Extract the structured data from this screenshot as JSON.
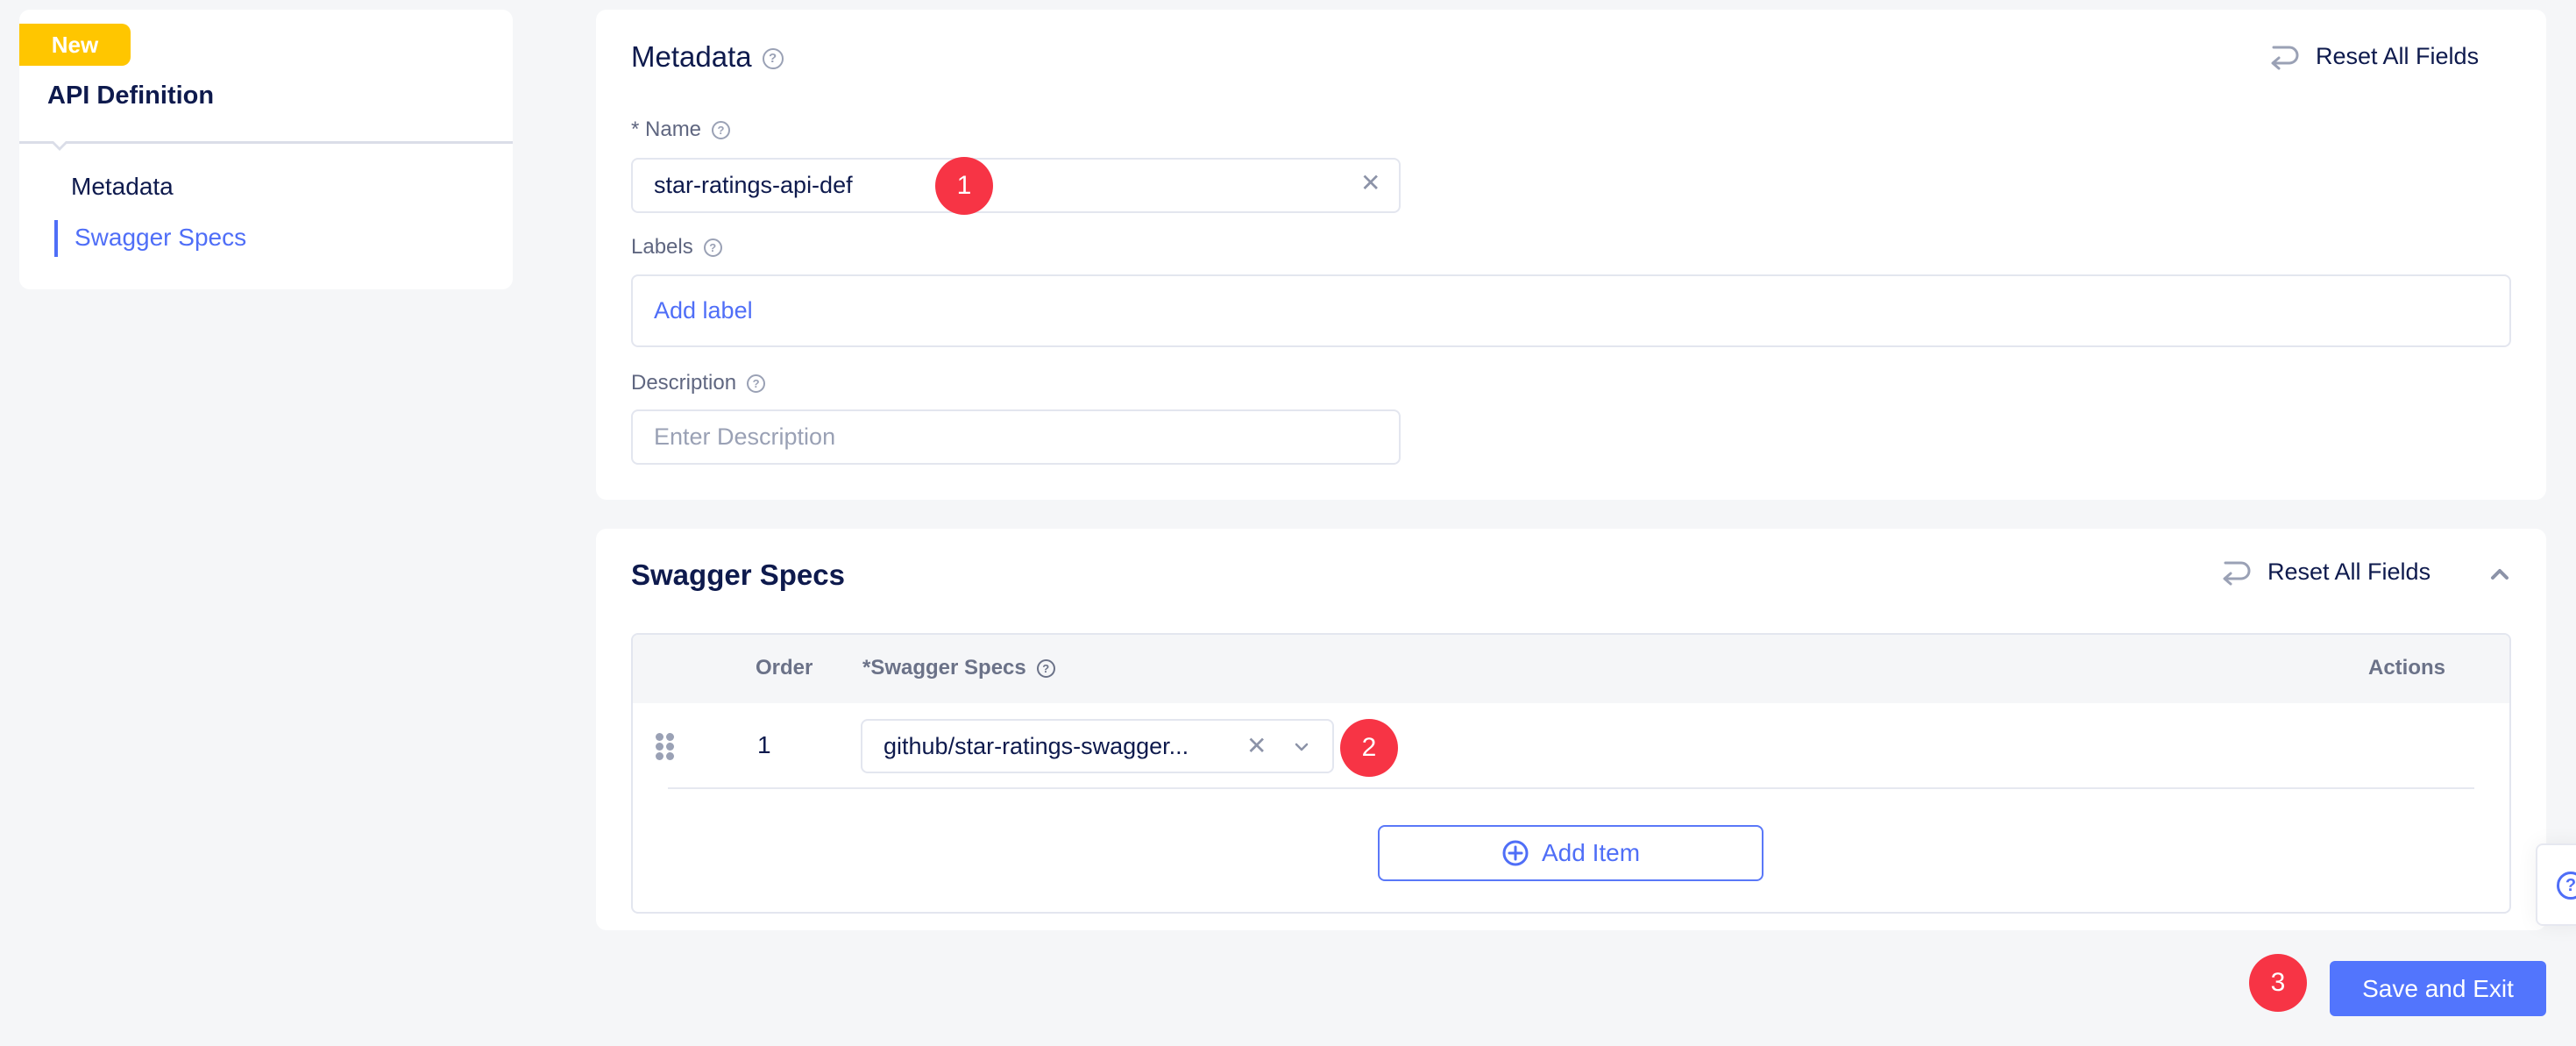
{
  "sidebar": {
    "badge": "New",
    "title": "API Definition",
    "items": [
      {
        "label": "Metadata",
        "active": false
      },
      {
        "label": "Swagger Specs",
        "active": true
      }
    ]
  },
  "metadata": {
    "title": "Metadata",
    "reset_label": "Reset All Fields",
    "name": {
      "label": "* Name",
      "value": "star-ratings-api-def"
    },
    "labels": {
      "label": "Labels",
      "add_label": "Add label"
    },
    "description": {
      "label": "Description",
      "placeholder": "Enter Description",
      "value": ""
    }
  },
  "swagger": {
    "title": "Swagger Specs",
    "reset_label": "Reset All Fields",
    "table": {
      "columns": [
        "Order",
        "*Swagger Specs",
        "Actions"
      ],
      "rows": [
        {
          "order": "1",
          "spec": "github/star-ratings-swagger..."
        }
      ]
    },
    "add_item_label": "Add Item"
  },
  "footer": {
    "save_label": "Save and Exit"
  },
  "markers": [
    "1",
    "2",
    "3"
  ],
  "colors": {
    "accent": "#4f6ef7",
    "badge": "#ffc600",
    "marker": "#f73445",
    "primary_button": "#5275fd"
  }
}
